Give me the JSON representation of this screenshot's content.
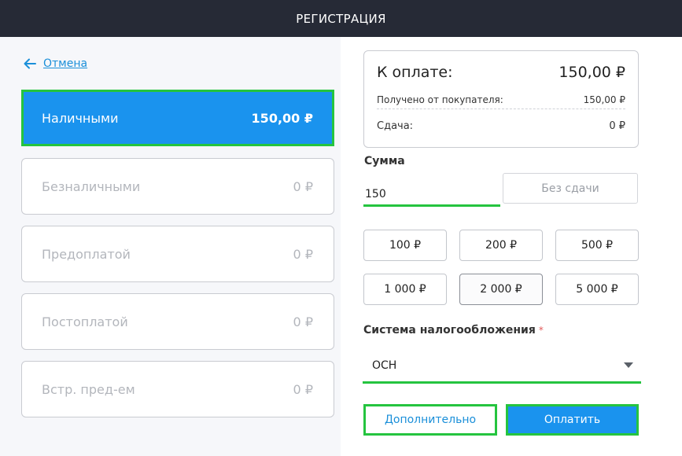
{
  "window": {
    "title": "РЕГИСТРАЦИЯ"
  },
  "nav": {
    "back_label": "Отмена"
  },
  "payment_methods": [
    {
      "label": "Наличными",
      "amount": "150,00 ₽",
      "active": true
    },
    {
      "label": "Безналичными",
      "amount": "0 ₽",
      "active": false
    },
    {
      "label": "Предоплатой",
      "amount": "0 ₽",
      "active": false
    },
    {
      "label": "Постоплатой",
      "amount": "0 ₽",
      "active": false
    },
    {
      "label": "Встр. пред-ем",
      "amount": "0 ₽",
      "active": false
    }
  ],
  "summary": {
    "due_label": "К оплате:",
    "due_value": "150,00 ₽",
    "received_label": "Получено от покупателя:",
    "received_value": "150,00 ₽",
    "change_label": "Сдача:",
    "change_value": "0 ₽"
  },
  "amount_field": {
    "label": "Сумма",
    "value": "150"
  },
  "no_change_label": "Без сдачи",
  "quick_amounts": [
    "100 ₽",
    "200 ₽",
    "500 ₽",
    "1 000 ₽",
    "2 000 ₽",
    "5 000 ₽"
  ],
  "tax": {
    "label": "Система налогообложения",
    "required_mark": "*",
    "value": "ОСН"
  },
  "buttons": {
    "extra_label": "Дополнительно",
    "pay_label": "Оплатить"
  },
  "colors": {
    "accent_blue": "#1a93ee",
    "focus_green": "#25c43f",
    "titlebar": "#262a36"
  }
}
